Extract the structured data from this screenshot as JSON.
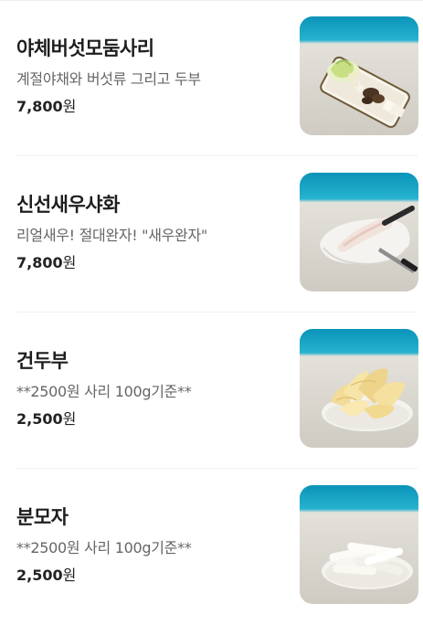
{
  "menu": {
    "items": [
      {
        "name": "야체버섯모둠사리",
        "description": "계절야채와 버섯류 그리고 두부",
        "price": "7,800",
        "currency": "원",
        "photo_icon": "vegetable-mushroom-platter-photo"
      },
      {
        "name": "신선새우샤화",
        "description": "리얼새우! 절대완자! \"새우완자\"",
        "price": "7,800",
        "currency": "원",
        "photo_icon": "shrimp-ball-paste-photo"
      },
      {
        "name": "건두부",
        "description": "**2500원 사리 100g기준**",
        "price": "2,500",
        "currency": "원",
        "photo_icon": "dried-tofu-sheets-photo"
      },
      {
        "name": "분모자",
        "description": "**2500원 사리 100g기준**",
        "price": "2,500",
        "currency": "원",
        "photo_icon": "glass-noodle-sticks-photo"
      }
    ]
  },
  "colors": {
    "photo_top_band": "#10a6c6",
    "photo_table": "#d9d6cf",
    "text_primary": "#1e1e1e",
    "text_secondary": "#666666"
  }
}
